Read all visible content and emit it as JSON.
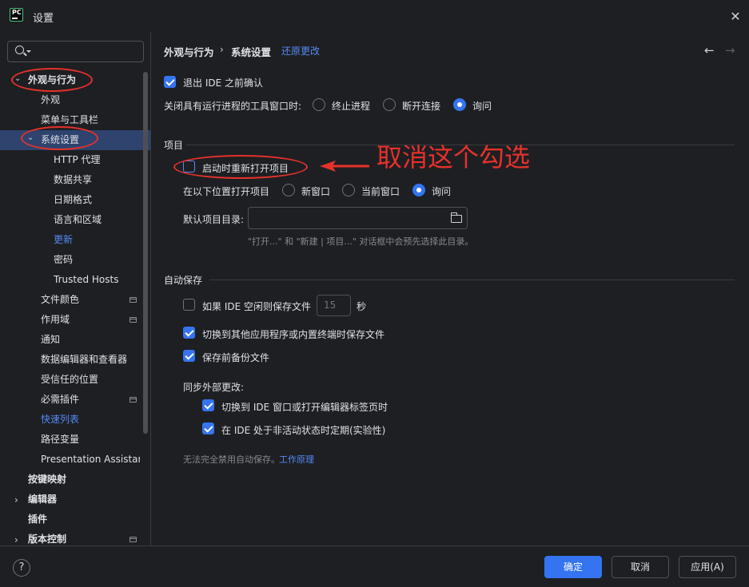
{
  "window": {
    "title": "设置",
    "close": "✕"
  },
  "search": {
    "placeholder": ""
  },
  "sidebar": {
    "items": [
      {
        "label": "外观与行为"
      },
      {
        "label": "外观"
      },
      {
        "label": "菜单与工具栏"
      },
      {
        "label": "系统设置"
      },
      {
        "label": "HTTP 代理"
      },
      {
        "label": "数据共享"
      },
      {
        "label": "日期格式"
      },
      {
        "label": "语言和区域"
      },
      {
        "label": "更新"
      },
      {
        "label": "密码"
      },
      {
        "label": "Trusted Hosts"
      },
      {
        "label": "文件颜色"
      },
      {
        "label": "作用域"
      },
      {
        "label": "通知"
      },
      {
        "label": "数据编辑器和查看器"
      },
      {
        "label": "受信任的位置"
      },
      {
        "label": "必需插件"
      },
      {
        "label": "快速列表"
      },
      {
        "label": "路径变量"
      },
      {
        "label": "Presentation Assistant"
      },
      {
        "label": "按键映射"
      },
      {
        "label": "编辑器"
      },
      {
        "label": "插件"
      },
      {
        "label": "版本控制"
      }
    ]
  },
  "breadcrumb": {
    "part1": "外观与行为",
    "sep": "›",
    "part2": "系统设置",
    "reset": "还原更改",
    "back": "←",
    "forward": "→"
  },
  "general": {
    "confirm_exit": "退出 IDE 之前确认",
    "close_tool_label": "关闭具有运行进程的工具窗口时:",
    "close_options": [
      "终止进程",
      "断开连接",
      "询问"
    ]
  },
  "project": {
    "section": "项目",
    "reopen": "启动时重新打开项目",
    "open_location_label": "在以下位置打开项目",
    "open_options": [
      "新窗口",
      "当前窗口",
      "询问"
    ],
    "default_dir_label": "默认项目目录:",
    "default_dir_value": "",
    "hint": "\"打开...\" 和 \"新建 | 项目...\" 对话框中会预先选择此目录。"
  },
  "autosave": {
    "section": "自动保存",
    "idle_save": "如果 IDE 空闲则保存文件",
    "idle_seconds": "15",
    "seconds_unit": "秒",
    "switch_app": "切换到其他应用程序或内置终端时保存文件",
    "backup": "保存前备份文件",
    "sync_label": "同步外部更改:",
    "sync_switch": "切换到 IDE 窗口或打开编辑器标签页时",
    "sync_inactive": "在 IDE 处于非活动状态时定期(实验性)",
    "note": "无法完全禁用自动保存。",
    "note_link": "工作原理"
  },
  "annotation": {
    "text": "取消这个勾选"
  },
  "footer": {
    "help": "?",
    "ok": "确定",
    "cancel": "取消",
    "apply": "应用(A)"
  },
  "colors": {
    "accent": "#3574f0",
    "annotation": "#e5312b",
    "background": "#1e1f22",
    "selection": "#2e436e"
  },
  "state": {
    "confirm_exit": true,
    "close_option_selected": "询问",
    "reopen": false,
    "open_option_selected": "询问",
    "idle_save": false,
    "switch_app": true,
    "backup": true,
    "sync_switch": true,
    "sync_inactive": true
  }
}
